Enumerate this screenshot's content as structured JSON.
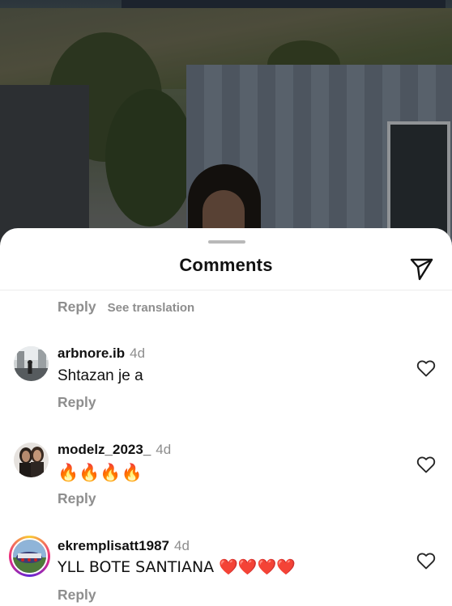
{
  "header": {
    "title": "Comments",
    "share_icon": "paper-plane-icon"
  },
  "top_actions": {
    "reply_label": "Reply",
    "see_translation_label": "See translation"
  },
  "comments": [
    {
      "username": "arbnore.ib",
      "time": "4d",
      "text": "Shtazan je a",
      "reply_label": "Reply",
      "avatar": "photo-avatar",
      "like_icon": "heart-outline-icon"
    },
    {
      "username": "modelz_2023_",
      "time": "4d",
      "text": "🔥🔥🔥🔥",
      "reply_label": "Reply",
      "avatar": "photo-avatar",
      "like_icon": "heart-outline-icon"
    },
    {
      "username": "ekremplisatt1987",
      "time": "4d",
      "text": "YLL BOTE SANTIANA ❤️❤️❤️❤️",
      "reply_label": "Reply",
      "avatar": "story-ring-avatar",
      "like_icon": "heart-outline-icon"
    }
  ],
  "colors": {
    "story_ring": "#ee2a7b",
    "secondary_text": "#8e8e8e",
    "heart_emoji": "#e0102a",
    "fire_emoji": "#ff6a00"
  }
}
